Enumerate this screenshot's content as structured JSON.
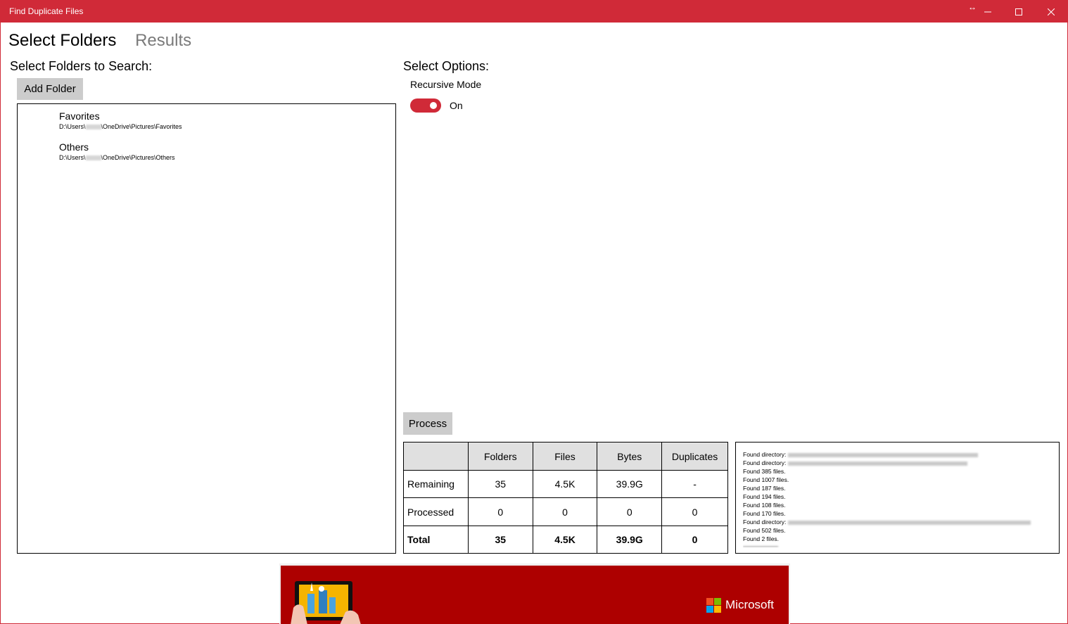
{
  "window": {
    "title": "Find Duplicate Files"
  },
  "nav": {
    "active": "Select Folders",
    "inactive": "Results"
  },
  "folders": {
    "heading": "Select Folders to Search:",
    "add_button": "Add Folder",
    "items": [
      {
        "name": "Favorites",
        "path_prefix": "D:\\Users\\",
        "path_suffix": "\\OneDrive\\Pictures\\Favorites"
      },
      {
        "name": "Others",
        "path_prefix": "D:\\Users\\",
        "path_suffix": "\\OneDrive\\Pictures\\Others"
      }
    ]
  },
  "options": {
    "heading": "Select Options:",
    "recursive_label": "Recursive Mode",
    "recursive_state": "On"
  },
  "process": {
    "button": "Process",
    "columns": [
      "",
      "Folders",
      "Files",
      "Bytes",
      "Duplicates"
    ],
    "rows": [
      {
        "label": "Remaining",
        "folders": "35",
        "files": "4.5K",
        "bytes": "39.9G",
        "duplicates": "-"
      },
      {
        "label": "Processed",
        "folders": "0",
        "files": "0",
        "bytes": "0",
        "duplicates": "0"
      },
      {
        "label": "Total",
        "folders": "35",
        "files": "4.5K",
        "bytes": "39.9G",
        "duplicates": "0"
      }
    ]
  },
  "log": {
    "lines": [
      "Found directory:",
      "Found directory:",
      "Found 385 files.",
      "Found 1007 files.",
      "Found 187 files.",
      "Found 194 files.",
      "Found 108 files.",
      "Found 170 files.",
      "Found directory:",
      "Found 502 files.",
      "Found 2 files."
    ]
  },
  "ad": {
    "brand": "Microsoft"
  },
  "colors": {
    "accent": "#d02a38",
    "ad_background": "#ad0000"
  }
}
